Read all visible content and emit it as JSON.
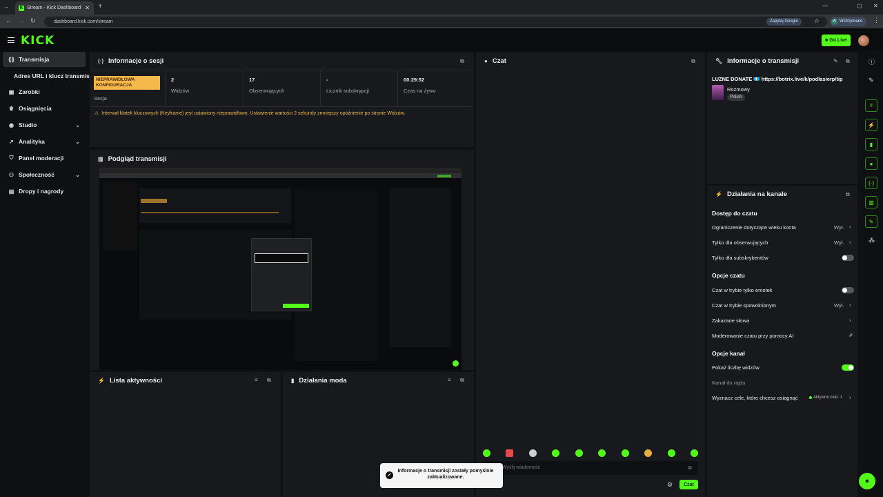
{
  "browser": {
    "tab_title": "Stream - Kick Dashboard",
    "url": "dashboard.kick.com/stream",
    "google_button": "Zapytaj Google",
    "profile_label": "Wstrzymano",
    "profile_initial": "W"
  },
  "header": {
    "logo": "KICK",
    "go_live": "Go Live"
  },
  "sidebar": {
    "items": [
      {
        "label": "Transmisja",
        "icon": "broadcast-icon"
      },
      {
        "label": "Adres URL i klucz transmisji",
        "icon": ""
      },
      {
        "label": "Zarobki",
        "icon": "wallet-icon"
      },
      {
        "label": "Osiągnięcia",
        "icon": "trophy-icon"
      },
      {
        "label": "Studio",
        "icon": "studio-icon"
      },
      {
        "label": "Analityka",
        "icon": "analytics-icon"
      },
      {
        "label": "Panel moderacji",
        "icon": "shield-icon"
      },
      {
        "label": "Społeczność",
        "icon": "community-icon"
      },
      {
        "label": "Dropy i nagrody",
        "icon": "gift-icon"
      }
    ]
  },
  "session": {
    "title": "Informacje o sesji",
    "badge": "NIEPRAWIDŁOWA KONFIGURACJA",
    "session_label": "Sesja",
    "stats": [
      {
        "value": "2",
        "label": "Widzów"
      },
      {
        "value": "17",
        "label": "Obserwujących"
      },
      {
        "value": "-",
        "label": "Licznik subskrypcji"
      },
      {
        "value": "00:29:52",
        "label": "Czas na żywo"
      }
    ],
    "warning": "Interwał klatek kluczowych (Keyframe) jest ustawiony nieprawidłowo. Ustawienie wartości 2 sekundy zmniejszy opóźnienie po stronie Widzów."
  },
  "preview": {
    "title": "Podgląd transmisji"
  },
  "activity": {
    "title": "Lista aktywności"
  },
  "mod_actions": {
    "title": "Działania moda"
  },
  "chat": {
    "title": "Czat",
    "placeholder": "Wyślij wiadomość",
    "send": "Czat",
    "toast": "Informacje o transmisji zostały pomyślnie zaktualizowane."
  },
  "stream_info": {
    "title": "Informacje o transmisji",
    "stream_title": "LUZNE DONATE 💶 https://botrix.live/k/podlasierp/tip",
    "category": "Rozmowy",
    "language_tag": "Polish"
  },
  "channel_actions": {
    "title": "Działania na kanale",
    "sections": {
      "chat_access": "Dostęp do czatu",
      "chat_options": "Opcje czatu",
      "channel_options": "Opcje kanał"
    },
    "rows": {
      "age": {
        "label": "Ograniczenie dotyczące wieku konta",
        "value": "Wył."
      },
      "followers": {
        "label": "Tylko dla obserwujących",
        "value": "Wył."
      },
      "subs": {
        "label": "Tylko dla subskrybentów"
      },
      "emotes": {
        "label": "Czat w trybie tylko emotek"
      },
      "slow": {
        "label": "Czat w trybie spowolnionym",
        "value": "Wył."
      },
      "banned": {
        "label": "Zakazane słowa"
      },
      "ai": {
        "label": "Moderowanie czatu przy pomocy AI"
      },
      "viewers": {
        "label": "Pokaż liczbę widzów"
      },
      "raid": {
        "label": "Kanał do rajdu"
      },
      "goals": {
        "label": "Wyznacz cele, które chcesz osiągnąć",
        "value": "Aktywne cele: 1"
      }
    },
    "toggles": {
      "subs": false,
      "emotes": false,
      "viewers": true
    }
  },
  "colors": {
    "accent": "#53fc18",
    "warning": "#f5b84b",
    "panel": "#18191c"
  }
}
